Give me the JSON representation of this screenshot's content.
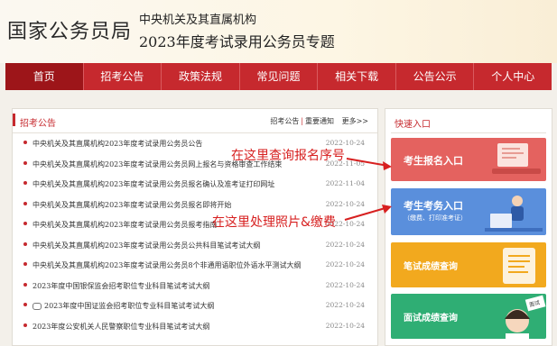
{
  "header": {
    "logo": "国家公务员局",
    "subtitle1": "中央机关及其直属机构",
    "subtitle2": "2023年度考试录用公务员专题"
  },
  "nav": [
    "首页",
    "招考公告",
    "政策法规",
    "常见问题",
    "相关下载",
    "公告公示",
    "个人中心"
  ],
  "panel": {
    "title": "招考公告",
    "links": [
      "招考公告",
      "重要通知",
      "更多>>"
    ],
    "items": [
      {
        "title": "中央机关及其直属机构2023年度考试录用公务员公告",
        "date": "2022-10-24"
      },
      {
        "title": "中央机关及其直属机构2023年度考试录用公务员网上报名与资格审查工作结束",
        "date": "2022-11-05"
      },
      {
        "title": "中央机关及其直属机构2023年度考试录用公务员报名确认及准考证打印网址",
        "date": "2022-11-04"
      },
      {
        "title": "中央机关及其直属机构2023年度考试录用公务员报名即将开始",
        "date": "2022-10-24"
      },
      {
        "title": "中央机关及其直属机构2023年度考试录用公务员报考指南",
        "date": "2022-10-24"
      },
      {
        "title": "中央机关及其直属机构2023年度考试录用公务员公共科目笔试考试大纲",
        "date": "2022-10-24"
      },
      {
        "title": "中央机关及其直属机构2023年度考试录用公务员8个非通用语职位外语水平测试大纲",
        "date": "2022-10-24"
      },
      {
        "title": "2023年度中国银保监会招考职位专业科目笔试考试大纲",
        "date": "2022-10-24"
      },
      {
        "title": "2023年度中国证监会招考职位专业科目笔试考试大纲",
        "date": "2022-10-24"
      },
      {
        "title": "2023年度公安机关人民警察职位专业科目笔试考试大纲",
        "date": "2022-10-24"
      }
    ]
  },
  "side": {
    "title": "快速入口",
    "buttons": [
      {
        "label": "考生报名入口",
        "sub": "",
        "color": "#e4625f"
      },
      {
        "label": "考生考务入口",
        "sub": "（缴费、打印准考证）",
        "color": "#5a8fdc"
      },
      {
        "label": "笔试成绩查询",
        "sub": "",
        "color": "#f2a91e"
      },
      {
        "label": "面试成绩查询",
        "sub": "",
        "color": "#2fae74"
      }
    ],
    "sign": "面试"
  },
  "annotations": {
    "a1": "在这里查询报名序号",
    "a2": "在这里处理照片&缴费"
  },
  "colors": {
    "brand": "#c6292e",
    "annotation": "#d72020"
  }
}
